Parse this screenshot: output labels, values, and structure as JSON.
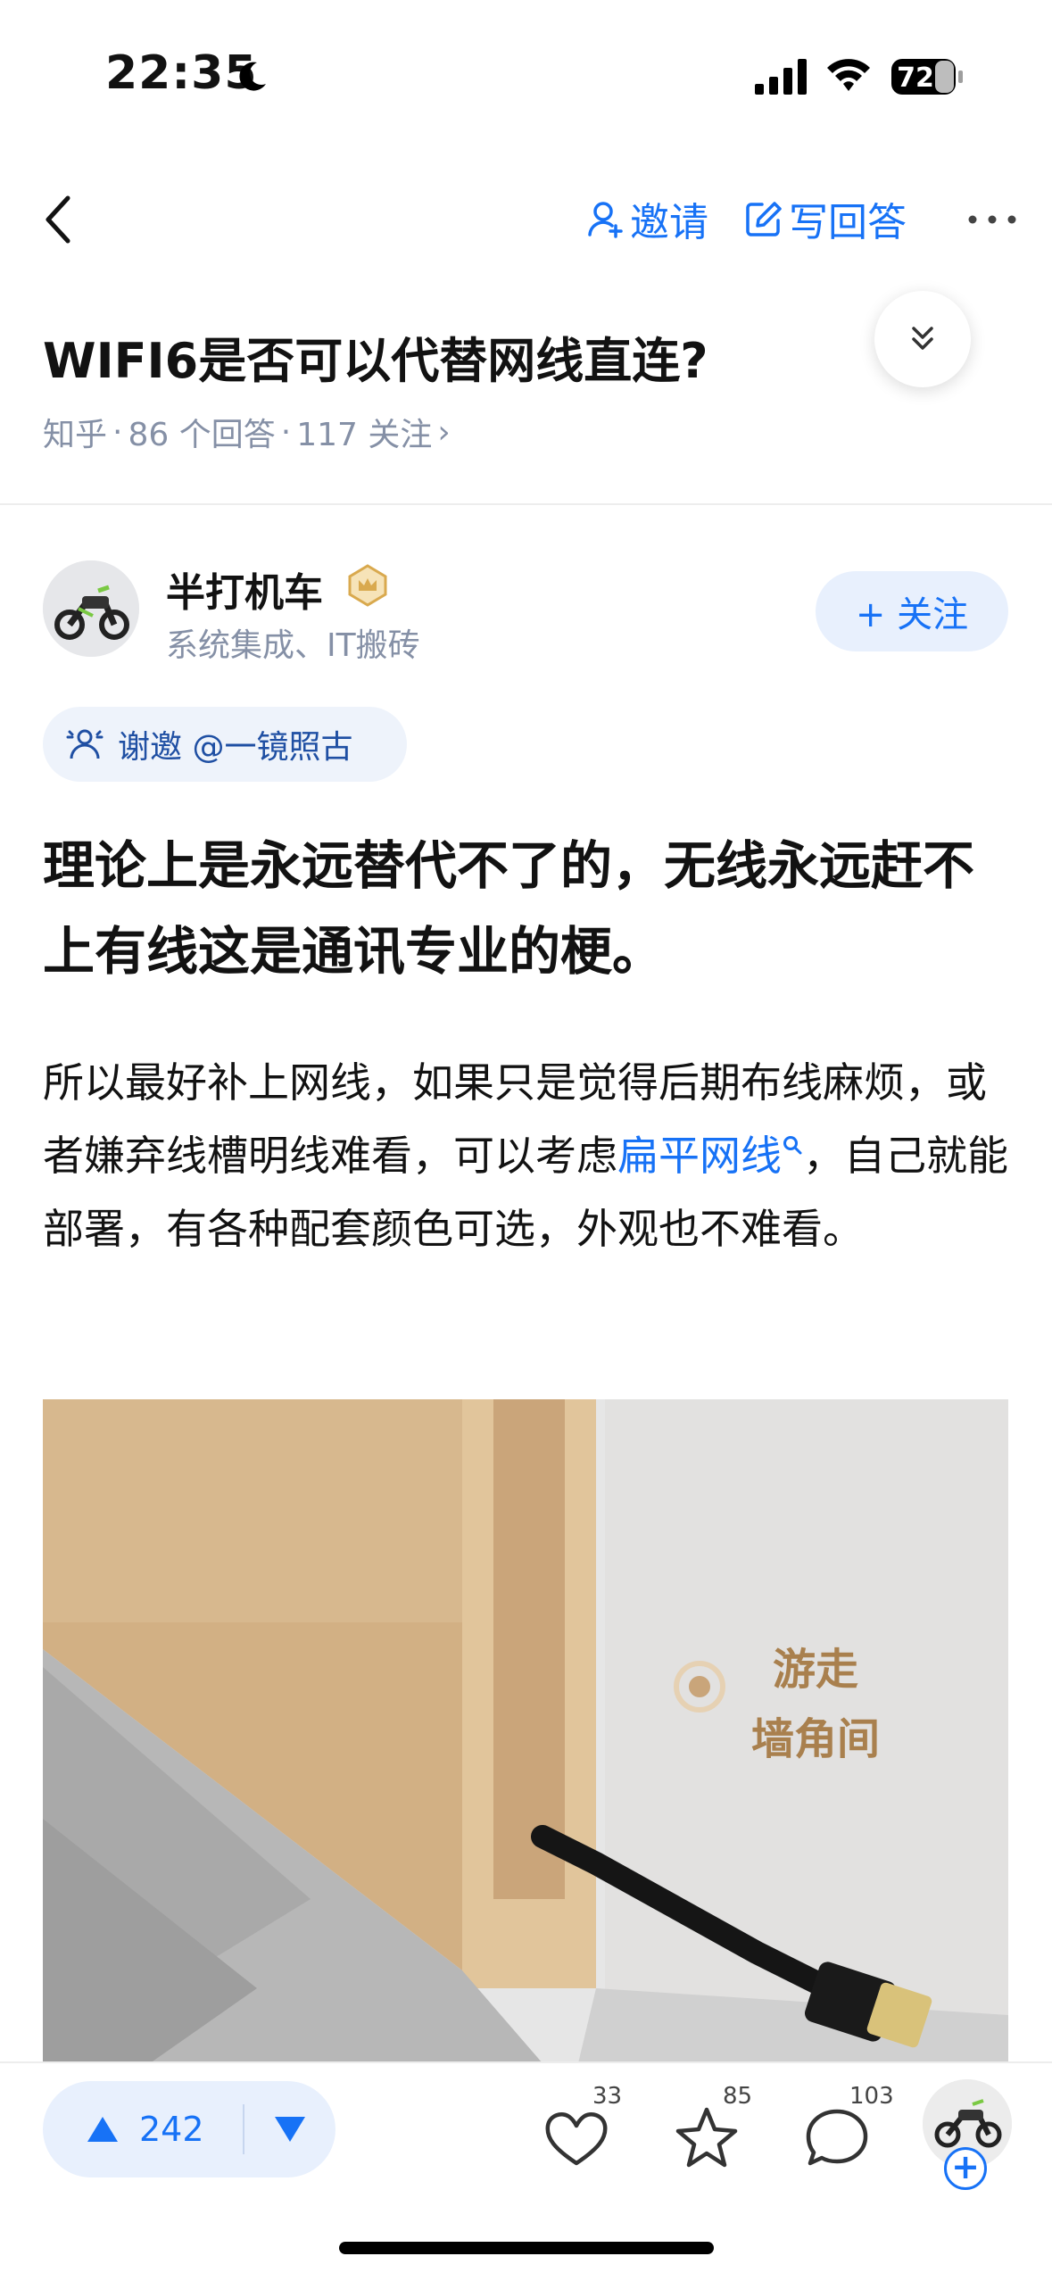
{
  "status_bar": {
    "time": "22:35",
    "battery": "72"
  },
  "nav": {
    "invite_label": "邀请",
    "write_answer_label": "写回答"
  },
  "question": {
    "title": "WIFI6是否可以代替网线直连?",
    "source": "知乎",
    "answers": "86 个回答",
    "follows": "117 关注",
    "sep": "·",
    "chevron": "›"
  },
  "author": {
    "name": "半打机车",
    "bio": "系统集成、IT搬砖",
    "follow_label": "+ 关注"
  },
  "thanks": {
    "label": "谢邀 @一镜照古"
  },
  "answer": {
    "lead": "理论上是永远替代不了的，无线永远赶不上有线这是通讯专业的梗。",
    "body_before": "所以最好补上网线，如果只是觉得后期布线麻烦，或者嫌弃线槽明线难看，可以考虑",
    "link_text": "扁平网线",
    "body_after": "，自己就能部署，有各种配套颜色可选，外观也不难看。"
  },
  "image": {
    "overlay_line1": "游走",
    "overlay_line2": "墙角间"
  },
  "bottom_bar": {
    "upvotes": "242",
    "likes": "33",
    "favorites": "85",
    "comments": "103",
    "plus": "+"
  },
  "colors": {
    "accent": "#1772f6",
    "pill_bg": "#e8f0fd",
    "meta_gray": "#8590a6"
  },
  "icons": [
    "moon-icon",
    "signal-icon",
    "wifi-icon",
    "battery-icon",
    "back-icon",
    "person-add-icon",
    "edit-icon",
    "more-icon",
    "double-chevron-down-icon",
    "crown-badge-icon",
    "thanks-icon",
    "search-icon",
    "upvote-icon",
    "downvote-icon",
    "heart-icon",
    "star-icon",
    "comment-icon"
  ]
}
